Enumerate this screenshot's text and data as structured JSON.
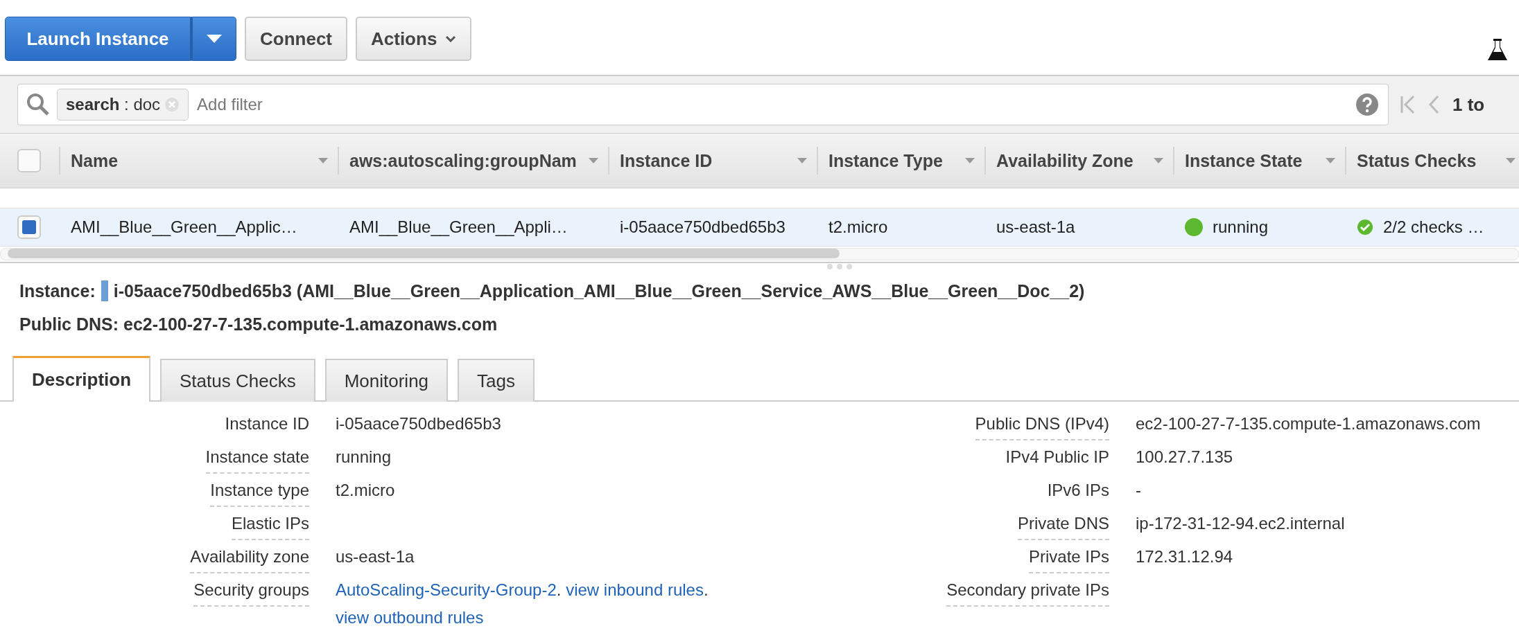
{
  "toolbar": {
    "buttons": [
      {
        "label": "Launch Instance",
        "kind": "split"
      },
      {
        "label": "Connect",
        "kind": "plain"
      },
      {
        "label": "Actions",
        "kind": "menu"
      }
    ]
  },
  "filter": {
    "tokens": [
      {
        "text": "**search** : doc"
      }
    ],
    "placeholder": "Add filter",
    "pagination": "1 to"
  },
  "table": {
    "select_all_checked": false,
    "columns": [
      "Name",
      "aws:autoscaling:groupNam",
      "Instance ID",
      "Instance Type",
      "Availability Zone",
      "Instance State",
      "Status Checks"
    ],
    "rows": [
      {
        "selected": true,
        "color": "#5cb82e",
        "cells": [
          "AMI__Blue__Green__Applic…",
          "AMI__Blue__Green__Appli…",
          "i-05aace750dbed65b3",
          "t2.micro",
          "us-east-1a",
          "running",
          "2/2 checks …"
        ]
      }
    ]
  },
  "details": {
    "label": "Instance:",
    "title": "i-05aace750dbed65b3 (AMI__Blue__Green__Application_AMI__Blue__Green__Service_AWS__Blue__Green__Doc__2)",
    "public_dns": "Public DNS: ec2-100-27-7-135.compute-1.amazonaws.com",
    "tabs": [
      {
        "label": "Description",
        "selected": true
      },
      {
        "label": "Status Checks",
        "selected": false
      },
      {
        "label": "Monitoring",
        "selected": false
      },
      {
        "label": "Tags",
        "selected": false
      }
    ],
    "left_fields": [
      {
        "label": "Instance ID",
        "has_help": false,
        "value": [
          {
            "kind": "text",
            "text": "i-05aace750dbed65b3"
          }
        ]
      },
      {
        "label": "Instance state",
        "has_help": true,
        "value": [
          {
            "kind": "text",
            "text": "running"
          }
        ]
      },
      {
        "label": "Instance type",
        "has_help": true,
        "value": [
          {
            "kind": "text",
            "text": "t2.micro"
          }
        ]
      },
      {
        "label": "Elastic IPs",
        "has_help": true
      },
      {
        "label": "Availability zone",
        "has_help": true,
        "value": [
          {
            "kind": "text",
            "text": "us-east-1a"
          }
        ]
      },
      {
        "label": "Security groups",
        "has_help": true,
        "value": [
          {
            "kind": "link",
            "text": "AutoScaling-Security-Group-2"
          },
          {
            "kind": "text",
            "text": ". "
          },
          {
            "kind": "link",
            "text": "view inbound rules"
          },
          {
            "kind": "text",
            "text": ". "
          },
          {
            "kind": "link",
            "text": "view outbound rules"
          }
        ]
      }
    ],
    "right_fields": [
      {
        "label": "Public DNS (IPv4)",
        "has_help": true,
        "value": [
          {
            "kind": "text",
            "text": "ec2-100-27-7-135.compute-1.amazonaws.com"
          }
        ]
      },
      {
        "label": "IPv4 Public IP",
        "has_help": false,
        "value": [
          {
            "kind": "text",
            "text": "100.27.7.135"
          }
        ]
      },
      {
        "label": "IPv6 IPs",
        "has_help": false,
        "value": [
          {
            "kind": "text",
            "text": "-"
          }
        ]
      },
      {
        "label": "Private DNS",
        "has_help": true,
        "value": [
          {
            "kind": "text",
            "text": "ip-172-31-12-94.ec2.internal"
          }
        ]
      },
      {
        "label": "Private IPs",
        "has_help": true,
        "value": [
          {
            "kind": "text",
            "text": "172.31.12.94"
          }
        ]
      },
      {
        "label": "Secondary private IPs",
        "has_help": true
      }
    ]
  }
}
